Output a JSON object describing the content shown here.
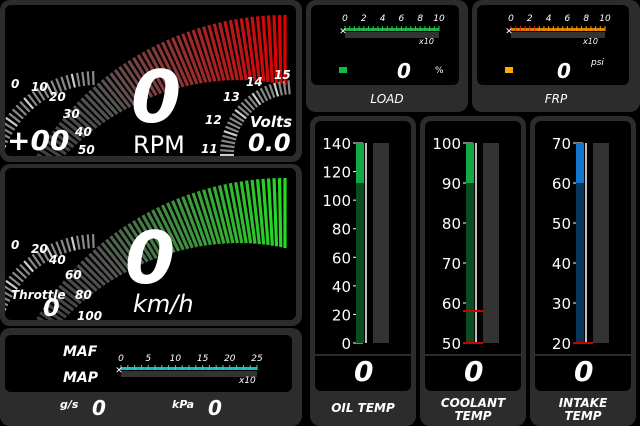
{
  "rpm": {
    "value": "0",
    "unit": "RPM",
    "scale_labels": [
      "0",
      "10",
      "20",
      "30",
      "40",
      "50"
    ],
    "prefix": "+00",
    "arc_start_color": "#444444",
    "arc_end_color": "#e00000"
  },
  "volts": {
    "value": "0.0",
    "label": "Volts",
    "scale_labels": [
      "11",
      "12",
      "13",
      "14",
      "15"
    ]
  },
  "speed": {
    "value": "0",
    "unit": "km/h",
    "scale_labels": [
      "0",
      "20",
      "40",
      "60",
      "80",
      "100"
    ],
    "arc_start_color": "#444444",
    "arc_end_color": "#22dd22"
  },
  "throttle": {
    "label": "Throttle",
    "value": "0"
  },
  "load": {
    "title": "LOAD",
    "ticks": [
      "0",
      "2",
      "4",
      "6",
      "8",
      "10"
    ],
    "multiplier": "x10",
    "value": "0",
    "unit": "%",
    "indicator_color": "#11bb44",
    "bar_color": "#22cc55"
  },
  "frp": {
    "title": "FRP",
    "ticks": [
      "0",
      "2",
      "4",
      "6",
      "8",
      "10"
    ],
    "multiplier": "x10",
    "value": "0",
    "unit": "psi",
    "indicator_color": "#ffaa00",
    "bar_color": "#ff9900"
  },
  "maf_map": {
    "maf_label": "MAF",
    "map_label": "MAP",
    "ticks": [
      "0",
      "5",
      "10",
      "15",
      "20",
      "25"
    ],
    "multiplier": "x10",
    "gs_label": "g/s",
    "gs_value": "0",
    "kpa_label": "kPa",
    "kpa_value": "0",
    "bar_color": "#22dddd"
  },
  "oil_temp": {
    "title": "OIL TEMP",
    "ticks": [
      "140",
      "120",
      "100",
      "80",
      "60",
      "40",
      "20",
      "0"
    ],
    "value": "0",
    "bar_color": "#11aa44"
  },
  "coolant_temp": {
    "title_line1": "COOLANT",
    "title_line2": "TEMP",
    "ticks": [
      "100",
      "90",
      "80",
      "70",
      "60",
      "50"
    ],
    "value": "0",
    "bar_color": "#11aa44",
    "marker_color": "#cc0000"
  },
  "intake_temp": {
    "title_line1": "INTAKE",
    "title_line2": "TEMP",
    "ticks": [
      "70",
      "60",
      "50",
      "40",
      "30",
      "20"
    ],
    "value": "0",
    "bar_color": "#1177cc",
    "marker_color": "#cc0000"
  }
}
